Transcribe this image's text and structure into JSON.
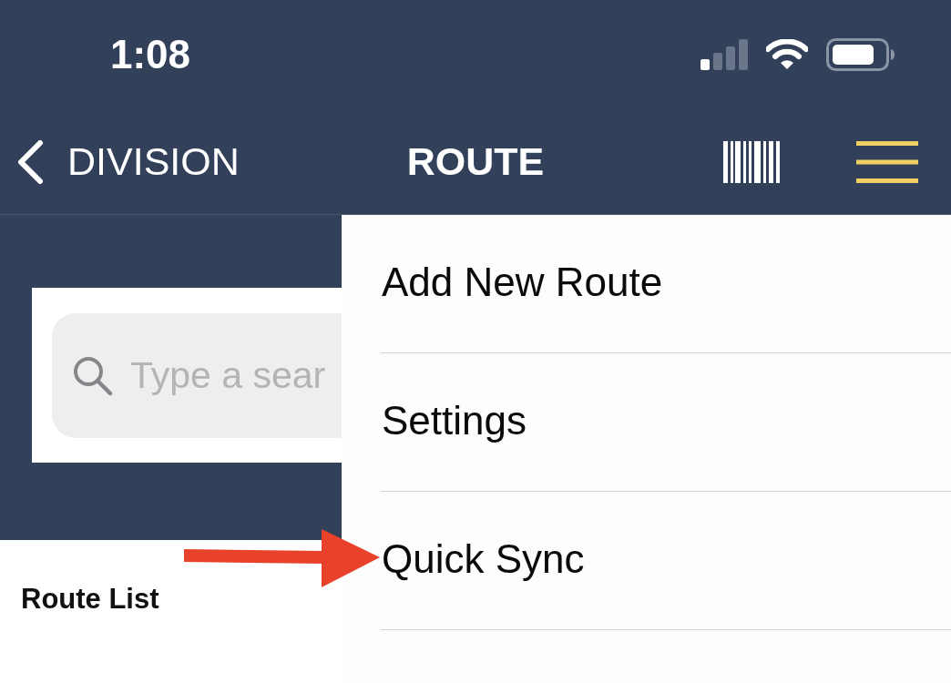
{
  "status_bar": {
    "time": "1:08"
  },
  "nav_bar": {
    "back_label": "DIVISION",
    "title": "ROUTE"
  },
  "search": {
    "placeholder": "Type a sear"
  },
  "section_title": "Route List",
  "menu": {
    "items": [
      {
        "label": "Add New Route"
      },
      {
        "label": "Settings"
      },
      {
        "label": "Quick Sync"
      }
    ]
  },
  "annotation": {
    "kind": "arrow"
  }
}
